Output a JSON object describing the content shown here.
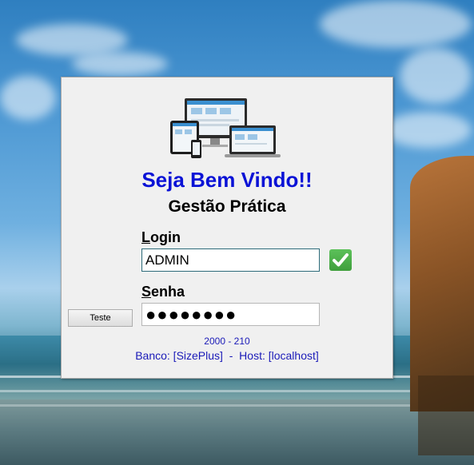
{
  "login_window": {
    "welcome_title": "Seja Bem Vindo!!",
    "company_name": "Gestão Prática",
    "login_label_accesskey": "L",
    "login_label_rest": "ogin",
    "login_value": "ADMIN",
    "senha_label_accesskey": "S",
    "senha_label_rest": "enha",
    "senha_value": "●●●●●●●●",
    "test_button": "Teste",
    "version": "2000 - 210",
    "banco_label": "Banco: [SizePlus]",
    "separator": "  -  ",
    "host_label": "Host: [localhost]"
  },
  "colors": {
    "welcome": "#0a12d6",
    "info_text": "#1a1ab8",
    "check_green": "#4caf4a"
  },
  "icons": {
    "logo": "devices-illustration-icon",
    "validated": "green-check-icon"
  }
}
